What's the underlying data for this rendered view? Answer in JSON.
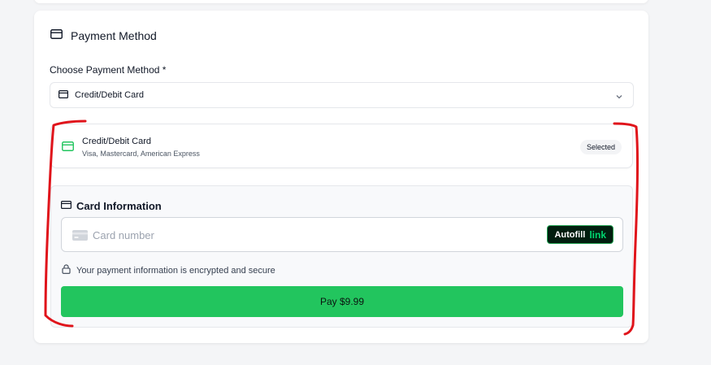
{
  "section": {
    "title": "Payment Method",
    "icon": "credit-card-icon"
  },
  "method_select": {
    "label": "Choose Payment Method *",
    "value": "Credit/Debit Card",
    "icon": "credit-card-icon",
    "dropdown_icon": "chevron-down-icon"
  },
  "option": {
    "title": "Credit/Debit Card",
    "subtitle": "Visa, Mastercard, American Express",
    "badge": "Selected",
    "icon_color": "#22c55e"
  },
  "card_info": {
    "title": "Card Information",
    "card_number_placeholder": "Card number",
    "autofill_label": "Autofill",
    "autofill_brand": "link",
    "secure_text": "Your payment information is encrypted and secure",
    "pay_label": "Pay $9.99"
  },
  "colors": {
    "accent_green": "#22c55e",
    "annotation_red": "#e0141b",
    "link_dark": "#011e0f",
    "link_green": "#00d66f"
  }
}
